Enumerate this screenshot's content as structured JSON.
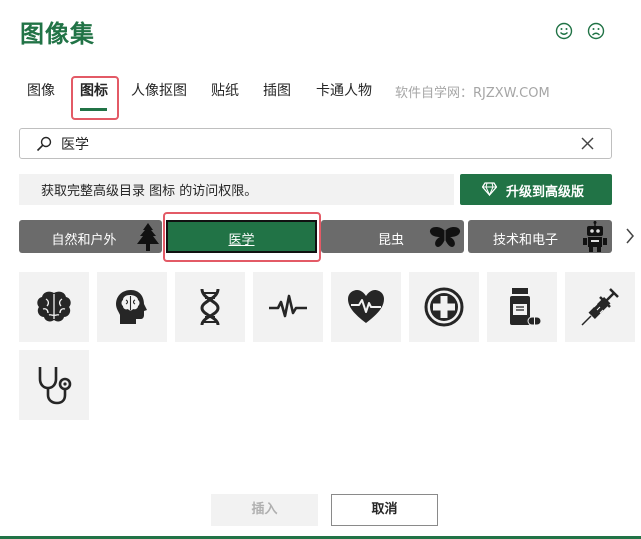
{
  "dialog": {
    "title": "图像集"
  },
  "feedback": {
    "smile_icon": "smile-face-icon",
    "frown_icon": "frown-face-icon"
  },
  "tabs": [
    {
      "label": "图像"
    },
    {
      "label": "图标",
      "active": true
    },
    {
      "label": "人像抠图"
    },
    {
      "label": "贴纸"
    },
    {
      "label": "插图"
    },
    {
      "label": "卡通人物"
    }
  ],
  "watermark": "软件自学网：RJZXW.COM",
  "search": {
    "value": "医学",
    "search_icon": "search-icon",
    "clear_icon": "clear-icon"
  },
  "banner": {
    "text": "获取完整高级目录 图标 的访问权限。"
  },
  "upgrade": {
    "label": "升级到高级版",
    "icon": "diamond-icon"
  },
  "categories": [
    {
      "label": "自然和户外",
      "icon": "tree-icon"
    },
    {
      "label": "医学",
      "selected": true
    },
    {
      "label": "昆虫",
      "icon": "butterfly-icon"
    },
    {
      "label": "技术和电子",
      "icon": "robot-icon"
    }
  ],
  "icons": [
    "brain-icon",
    "head-brain-icon",
    "dna-icon",
    "heartbeat-icon",
    "heart-pulse-icon",
    "medical-cross-icon",
    "medicine-bottle-icon",
    "syringe-icon",
    "stethoscope-icon"
  ],
  "footer": {
    "insert_label": "插入",
    "cancel_label": "取消"
  },
  "colors": {
    "accent": "#217346",
    "highlight": "#e35a66",
    "category_bg": "#6b6b6b",
    "tile_bg": "#f2f2f2"
  }
}
